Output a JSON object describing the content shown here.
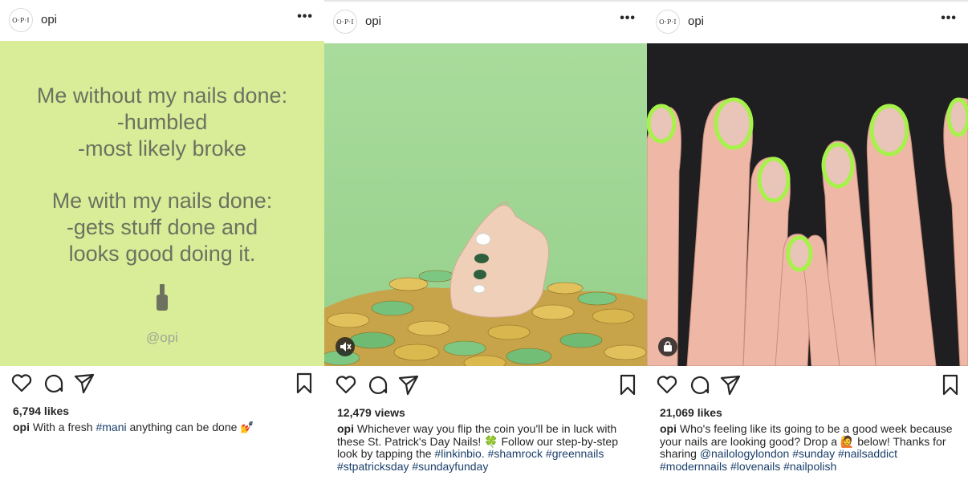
{
  "posts": [
    {
      "avatar_text": "O·P·I",
      "username": "opi",
      "count": "6,794 likes",
      "caption_user": "opi",
      "caption_parts": [
        "With a fresh ",
        "#mani",
        " anything can be done 💅"
      ],
      "quote": {
        "line1": "Me without my nails done:",
        "line2": "-humbled",
        "line3": "-most likely broke",
        "line4": "Me with my nails done:",
        "line5": "-gets stuff done and",
        "line6": "looks good doing it.",
        "handle": "@opi"
      },
      "colors": {
        "background": "#d9ed98",
        "text": "#6d7160"
      }
    },
    {
      "avatar_text": "O·P·I",
      "username": "opi",
      "count": "12,479 views",
      "caption_user": "opi",
      "caption_text_a": "Whichever way you flip the coin you'll be in luck with these St. Patrick's Day Nails! 🍀 Follow our step-by-step look by tapping the ",
      "caption_tags_a": "#linkinbio.",
      "caption_tags_b": "#shamrock #greennails #stpatricksday #sundayfunday",
      "media_icon": "mute-icon",
      "colors": {
        "background": "#a7d89a",
        "coin_gold": "#d8b451",
        "coin_green": "#5fb36a"
      }
    },
    {
      "avatar_text": "O·P·I",
      "username": "opi",
      "count": "21,069 likes",
      "caption_user": "opi",
      "caption_text_a": "Who's feeling like its going to be a good week because your nails are looking good? Drop a 🙋 below! Thanks for sharing ",
      "caption_tags_a": "@nailologylondon #sunday #nailsaddict #modernnails #lovenails #nailpolish",
      "media_icon": "shopping-bag-icon",
      "colors": {
        "background": "#1c1c1e",
        "skin": "#efb8a6",
        "neon": "#a6f24a"
      }
    }
  ]
}
